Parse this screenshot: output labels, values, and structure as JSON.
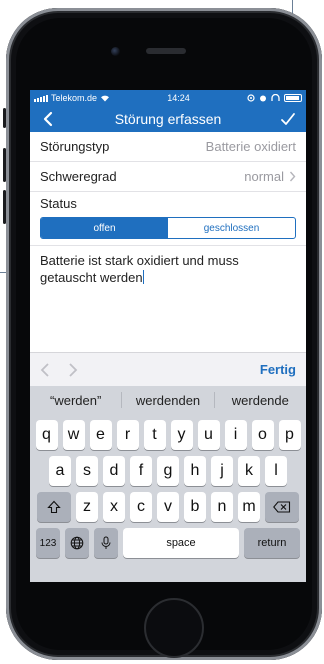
{
  "status_bar": {
    "carrier": "Telekom.de",
    "time": "14:24"
  },
  "nav": {
    "title": "Störung erfassen"
  },
  "form": {
    "rows": [
      {
        "label": "Störungstyp",
        "value": "Batterie oxidiert"
      },
      {
        "label": "Schweregrad",
        "value": "normal"
      }
    ],
    "status_label": "Status",
    "status_options": [
      "offen",
      "geschlossen"
    ],
    "status_selected": "offen",
    "description": "Batterie ist stark oxidiert und muss getauscht werden"
  },
  "keyboard_toolbar": {
    "done_label": "Fertig"
  },
  "keyboard": {
    "suggestions": [
      "“werden”",
      "werdenden",
      "werdende"
    ],
    "row1": [
      "q",
      "w",
      "e",
      "r",
      "t",
      "y",
      "u",
      "i",
      "o",
      "p"
    ],
    "row2": [
      "a",
      "s",
      "d",
      "f",
      "g",
      "h",
      "j",
      "k",
      "l"
    ],
    "row3": [
      "z",
      "x",
      "c",
      "v",
      "b",
      "n",
      "m"
    ],
    "numbers_label": "123",
    "space_label": "space",
    "return_label": "return"
  },
  "colors": {
    "accent": "#1f6fbf",
    "keyboard_bg": "#d2d5db"
  },
  "icons": {
    "back": "chevron-left-icon",
    "confirm": "checkmark-icon",
    "disclosure": "chevron-right-icon",
    "shift": "shift-icon",
    "delete": "delete-icon",
    "globe": "globe-icon",
    "mic": "microphone-icon"
  }
}
